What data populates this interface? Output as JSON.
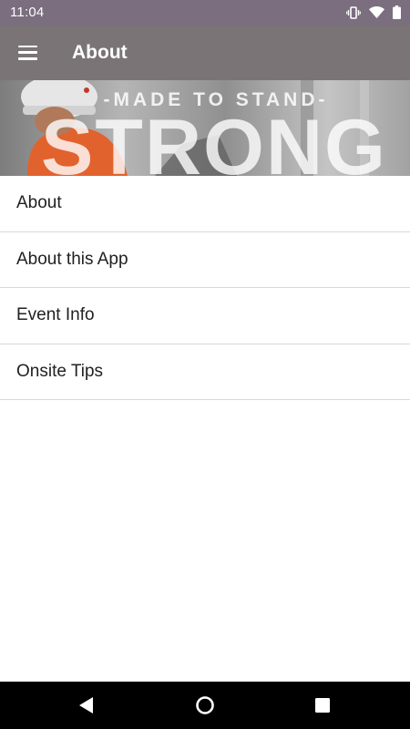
{
  "status_bar": {
    "time": "11:04",
    "icons": [
      "vibrate-icon",
      "wifi-icon",
      "battery-icon"
    ]
  },
  "app_bar": {
    "title": "About",
    "menu_icon": "hamburger-menu-icon",
    "background_color": "#7a7476"
  },
  "banner": {
    "tagline": "-MADE TO STAND-",
    "headline": "STRONG"
  },
  "menu": {
    "items": [
      {
        "label": "About"
      },
      {
        "label": "About this App"
      },
      {
        "label": "Event Info"
      },
      {
        "label": "Onsite Tips"
      }
    ]
  },
  "nav_bar": {
    "buttons": [
      "back-icon",
      "home-icon",
      "recents-icon"
    ]
  },
  "colors": {
    "status_bar": "#7a6e7f",
    "app_bar": "#7a7476",
    "divider": "#d8d8d8",
    "text": "#212121"
  }
}
